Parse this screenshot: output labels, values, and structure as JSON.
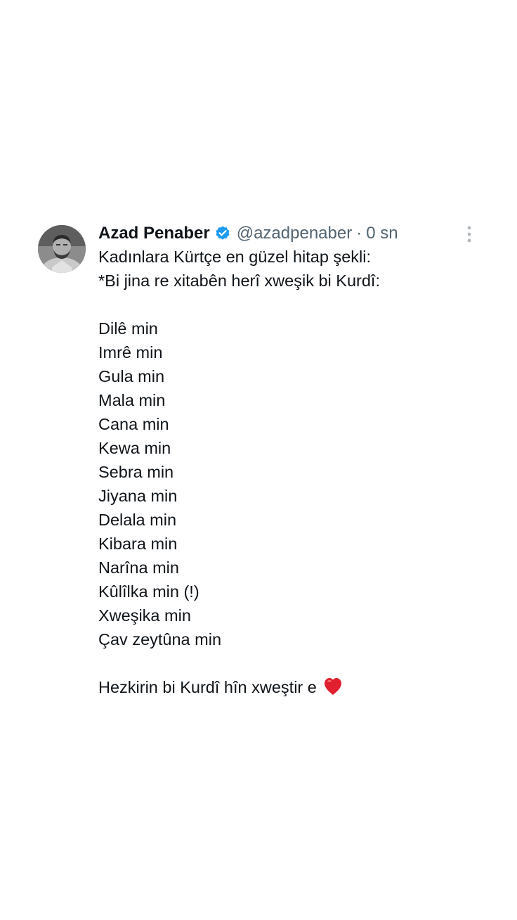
{
  "tweet": {
    "author": {
      "display_name": "Azad Penaber",
      "handle": "@azadpenaber",
      "verified": true,
      "verified_color": "#1d9bf0",
      "avatar": "profile-photo"
    },
    "separator": "·",
    "time": "0 sn",
    "more_icon": "more-vertical-icon",
    "intro_lines": [
      "Kadınlara Kürtçe en güzel hitap şekli:",
      "*Bi jina re xitabên herî xweşik bi Kurdî:"
    ],
    "phrases": [
      "Dilê min",
      "Imrê min",
      "Gula min",
      "Mala min",
      "Cana min",
      "Kewa min",
      "Sebra min",
      "Jiyana min",
      "Delala min",
      "Kibara min",
      "Narîna min",
      "Kûlîlka min (!)",
      "Xweşika min",
      "Çav zeytûna min"
    ],
    "closing": "Hezkirin bi Kurdî hîn xweştir e",
    "closing_emoji": "red-heart-icon",
    "colors": {
      "text": "#0f1419",
      "secondary": "#536471",
      "heart": "#e0202e"
    }
  }
}
